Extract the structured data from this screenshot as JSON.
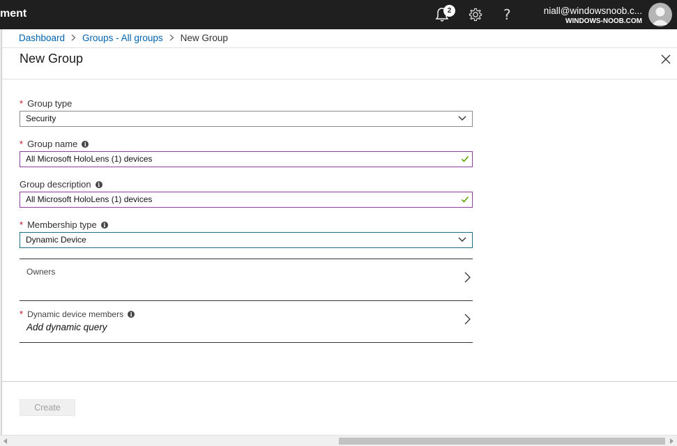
{
  "topbar": {
    "title": "ment",
    "notifications_count": "2",
    "help_glyph": "?",
    "user_email": "niall@windowsnoob.c...",
    "user_tenant": "WINDOWS-NOOB.COM"
  },
  "breadcrumb": {
    "items": [
      "Dashboard",
      "Groups - All groups"
    ],
    "current": "New Group"
  },
  "blade": {
    "title": "New Group"
  },
  "form": {
    "group_type": {
      "label": "Group type",
      "required": true,
      "value": "Security"
    },
    "group_name": {
      "label": "Group name",
      "required": true,
      "value": "All Microsoft HoloLens (1) devices"
    },
    "group_description": {
      "label": "Group description",
      "required": false,
      "value": "All Microsoft HoloLens (1) devices"
    },
    "membership_type": {
      "label": "Membership type",
      "required": true,
      "value": "Dynamic Device"
    },
    "owners": {
      "label": "Owners"
    },
    "dynamic_members": {
      "label": "Dynamic device members",
      "required": true,
      "action": "Add dynamic query"
    },
    "required_marker": "*",
    "info_glyph": "i"
  },
  "footer": {
    "create_label": "Create"
  },
  "colors": {
    "topbar_bg": "#1f1f1f",
    "link": "#0062ad",
    "required": "#c50f1f",
    "valid_check": "#57a300",
    "valid_border": "#8a3d9a"
  },
  "icons": {
    "notifications": "bell-icon",
    "settings": "gear-icon",
    "help": "question-icon",
    "close": "close-icon",
    "dropdown": "chevron-down-icon",
    "navigate": "chevron-right-icon",
    "valid": "checkmark-icon",
    "info": "info-icon"
  }
}
